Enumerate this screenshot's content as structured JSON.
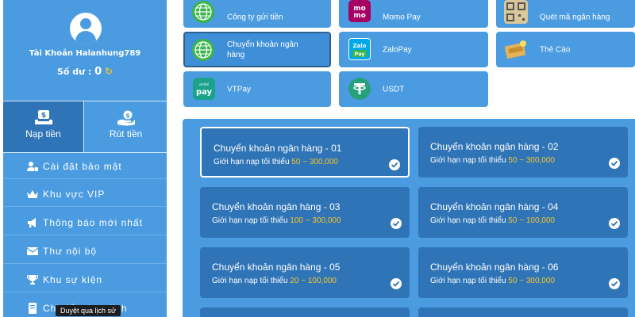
{
  "account": {
    "name": "Tài Khoản Halanhung789",
    "balance_label": "Số dư :",
    "balance_value": "0"
  },
  "action_tabs": [
    {
      "label": "Nạp tiền",
      "icon": "deposit-money-icon",
      "active": true
    },
    {
      "label": "Rút tiền",
      "icon": "withdraw-money-icon",
      "active": false
    }
  ],
  "menu": [
    {
      "label": "Cài đặt bảo mật",
      "icon": "user-lock-icon"
    },
    {
      "label": "Khu vực VIP",
      "icon": "crown-icon"
    },
    {
      "label": "Thông báo mới nhất",
      "icon": "megaphone-icon"
    },
    {
      "label": "Thư nội bộ",
      "icon": "envelope-icon"
    },
    {
      "label": "Khu sự kiện",
      "icon": "trophy-icon"
    },
    {
      "label": "Chi tiết giao dịch",
      "icon": "receipt-icon"
    }
  ],
  "tooltip": "Duyệt qua lịch sử",
  "methods": [
    {
      "label": "Công ty gửi tiền",
      "icon": "globe-icon",
      "selected": false
    },
    {
      "label": "Momo Pay",
      "icon": "momo-logo-icon",
      "selected": false
    },
    {
      "label": "Quét mã ngân hàng",
      "icon": "qr-code-icon",
      "selected": false
    },
    {
      "label": "Chuyển khoản ngân hàng",
      "icon": "globe-icon",
      "selected": true
    },
    {
      "label": "ZaloPay",
      "icon": "zalopay-logo-icon",
      "selected": false
    },
    {
      "label": "Thẻ Cào",
      "icon": "scratch-card-icon",
      "selected": false
    },
    {
      "label": "VTPay",
      "icon": "vtpay-logo-icon",
      "selected": false
    },
    {
      "label": "USDT",
      "icon": "tether-icon",
      "selected": false
    }
  ],
  "bank_options": [
    {
      "title": "Chuyển khoản ngân hàng - 01",
      "limit_label": "Giới hạn nạp tối thiểu",
      "range": "50 ~ 300,000",
      "selected": true
    },
    {
      "title": "Chuyển khoản ngân hàng - 02",
      "limit_label": "Giới hạn nạp tối thiểu",
      "range": "50 ~ 300,000",
      "selected": false
    },
    {
      "title": "Chuyển khoản ngân hàng - 03",
      "limit_label": "Giới hạn nạp tối thiểu",
      "range": "100 ~ 300,000",
      "selected": false
    },
    {
      "title": "Chuyển khoản ngân hàng - 04",
      "limit_label": "Giới hạn nạp tối thiểu",
      "range": "50 ~ 100,000",
      "selected": false
    },
    {
      "title": "Chuyển khoản ngân hàng - 05",
      "limit_label": "Giới hạn nạp tối thiểu",
      "range": "20 ~ 100,000",
      "selected": false
    },
    {
      "title": "Chuyển khoản ngân hàng - 06",
      "limit_label": "Giới hạn nạp tối thiểu",
      "range": "50 ~ 300,000",
      "selected": false
    }
  ],
  "colors": {
    "sidebar_bg": "#4a9be0",
    "card_bg": "#2f74b6",
    "range_accent": "#f4c430"
  }
}
